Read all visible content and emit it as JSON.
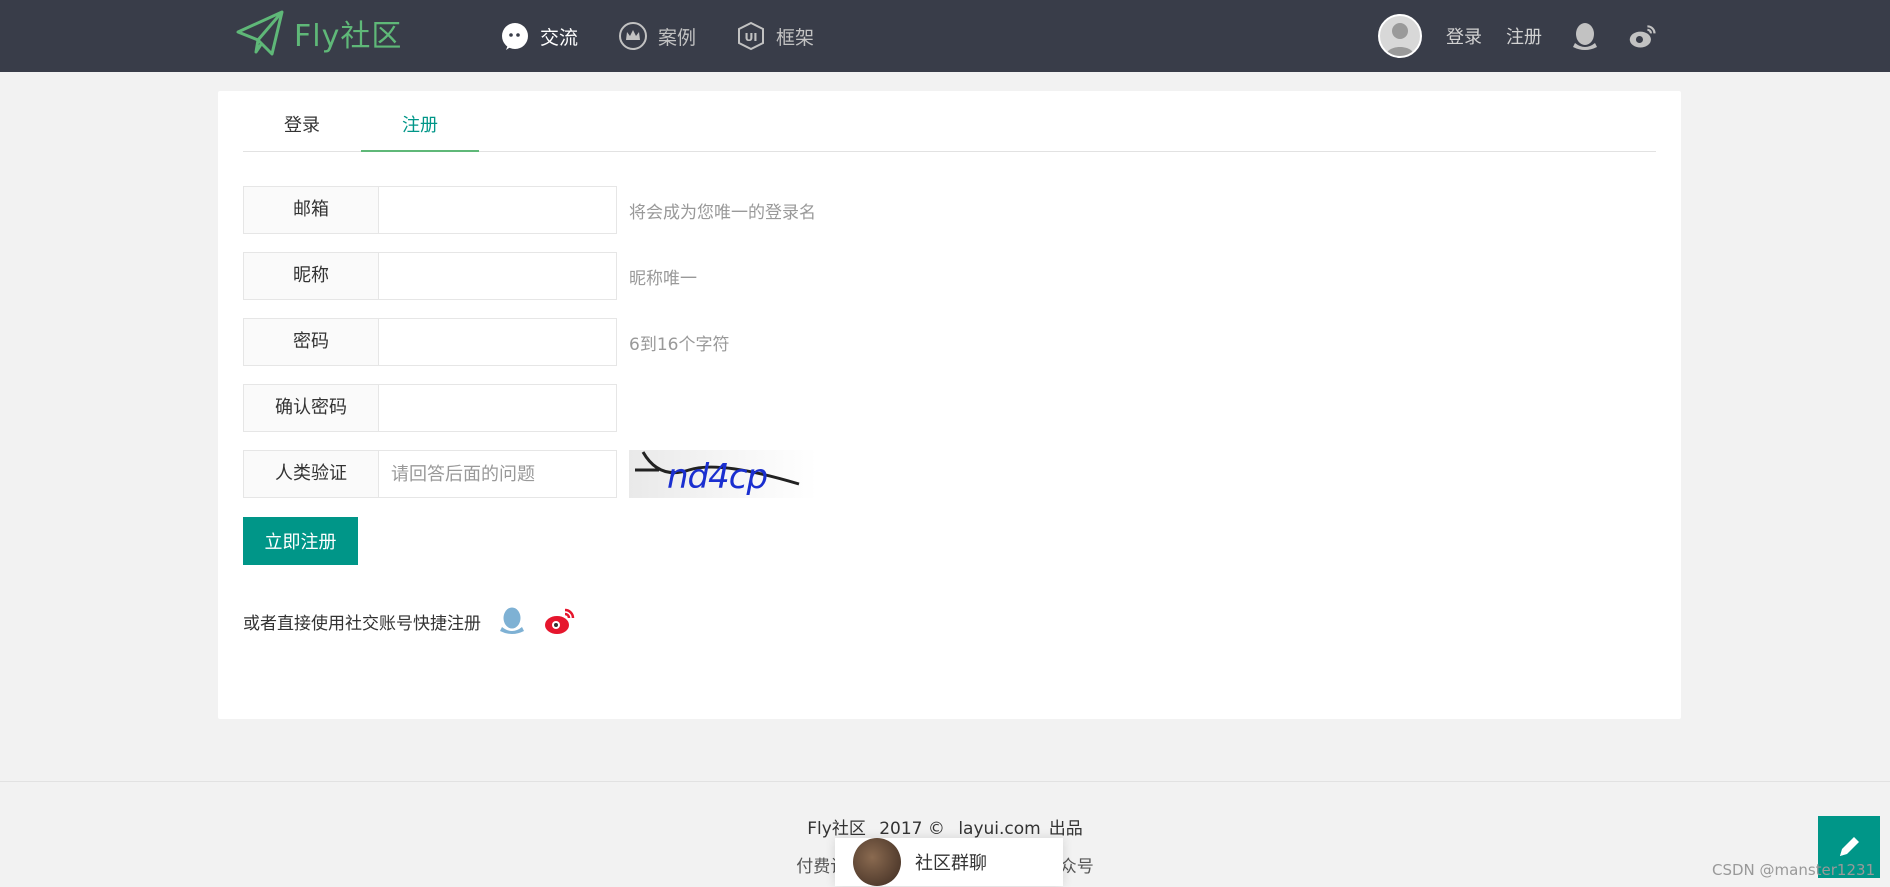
{
  "header": {
    "logo_text": "Fly社区",
    "nav": [
      {
        "label": "交流",
        "icon": "chat-icon",
        "active": true
      },
      {
        "label": "案例",
        "icon": "crown-icon",
        "active": false
      },
      {
        "label": "框架",
        "icon": "ui-icon",
        "active": false
      }
    ],
    "login_label": "登录",
    "register_label": "注册",
    "social_icons": [
      "qq-icon",
      "weibo-icon"
    ]
  },
  "tabs": [
    {
      "label": "登录",
      "active": false
    },
    {
      "label": "注册",
      "active": true
    }
  ],
  "form": {
    "email": {
      "label": "邮箱",
      "value": "",
      "placeholder": "",
      "tip": "将会成为您唯一的登录名"
    },
    "nickname": {
      "label": "昵称",
      "value": "",
      "placeholder": "",
      "tip": "昵称唯一"
    },
    "password": {
      "label": "密码",
      "value": "",
      "placeholder": "",
      "tip": "6到16个字符"
    },
    "confirm_password": {
      "label": "确认密码",
      "value": "",
      "placeholder": ""
    },
    "captcha": {
      "label": "人类验证",
      "value": "",
      "placeholder": "请回答后面的问题",
      "code": "nd4cp"
    },
    "submit_label": "立即注册"
  },
  "social_register": {
    "text": "或者直接使用社交账号快捷注册",
    "icons": [
      "qq-icon",
      "weibo-icon"
    ]
  },
  "footer": {
    "brand": "Fly社区",
    "copyright": "2017 ©",
    "link": "layui.com",
    "suffix": "出品",
    "line2_left": "付费计",
    "line2_right": "公众号"
  },
  "chat_popup": {
    "label": "社区群聊"
  },
  "watermark": "CSDN @manster1231",
  "colors": {
    "header_bg": "#393d49",
    "accent": "#009688",
    "logo_green": "#5fb878"
  }
}
